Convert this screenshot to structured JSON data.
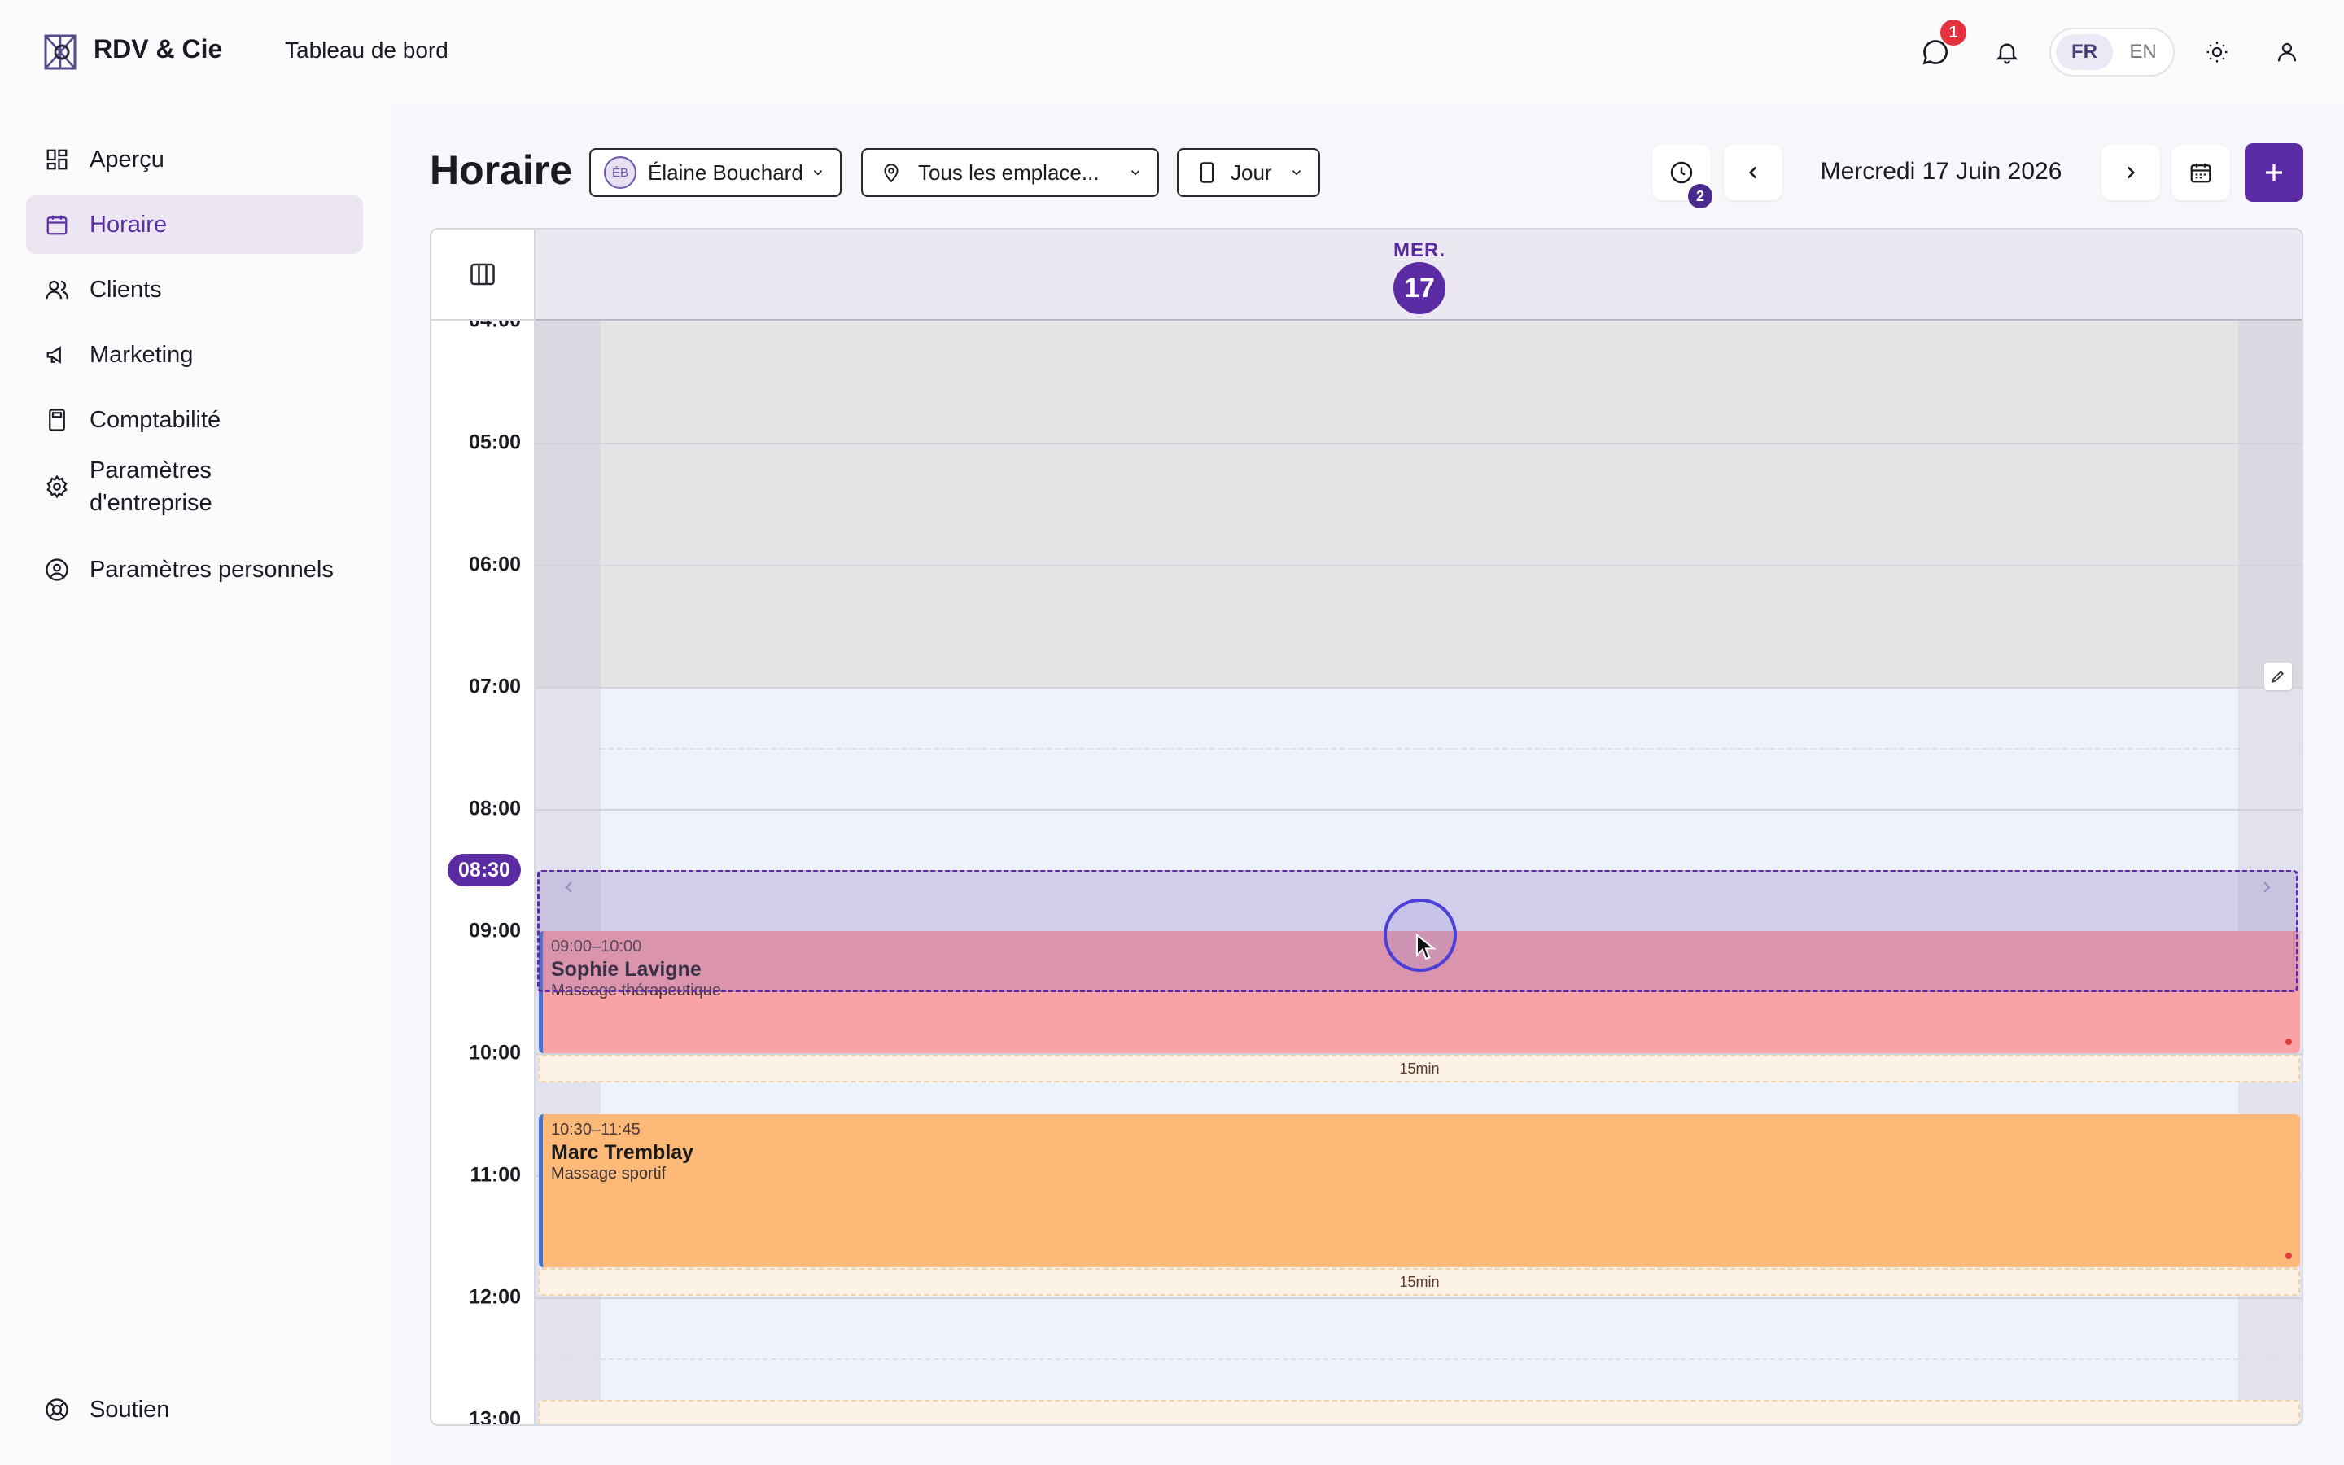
{
  "app": {
    "brand": "RDV & Cie",
    "page_title": "Tableau de bord"
  },
  "topbar": {
    "messages_badge": "1",
    "lang_fr": "FR",
    "lang_en": "EN"
  },
  "sidebar": {
    "items": [
      {
        "label": "Aperçu",
        "icon": "dashboard-icon",
        "active": false
      },
      {
        "label": "Horaire",
        "icon": "calendar-icon",
        "active": true
      },
      {
        "label": "Clients",
        "icon": "users-icon",
        "active": false
      },
      {
        "label": "Marketing",
        "icon": "megaphone-icon",
        "active": false
      },
      {
        "label": "Comptabilité",
        "icon": "calculator-icon",
        "active": false
      },
      {
        "label": "Paramètres d'entreprise",
        "icon": "gear-icon",
        "active": false
      },
      {
        "label": "Paramètres personnels",
        "icon": "user-circle-icon",
        "active": false
      }
    ],
    "support": "Soutien"
  },
  "schedule": {
    "title": "Horaire",
    "staff": {
      "initials": "ÉB",
      "name": "Élaine Bouchard"
    },
    "location": "Tous les emplace...",
    "view": "Jour",
    "history_badge": "2",
    "date": "Mercredi 17 Juin 2026",
    "day_of_week": "MER.",
    "day_number": "17",
    "current_time": "08:30"
  },
  "calendar": {
    "hours": [
      "04:00",
      "05:00",
      "06:00",
      "07:00",
      "08:00",
      "09:00",
      "10:00",
      "11:00",
      "12:00",
      "13:00"
    ],
    "appointments": [
      {
        "time": "09:00–10:00",
        "client": "Sophie Lavigne",
        "service": "Massage thérapeutique",
        "color": "#f9a3a6",
        "buffer": "15min"
      },
      {
        "time": "10:30–11:45",
        "client": "Marc Tremblay",
        "service": "Massage sportif",
        "color": "#fdb977",
        "buffer": "15min"
      }
    ]
  },
  "colors": {
    "accent": "#5b2ba3",
    "appointment_border": "#3b74d8"
  }
}
